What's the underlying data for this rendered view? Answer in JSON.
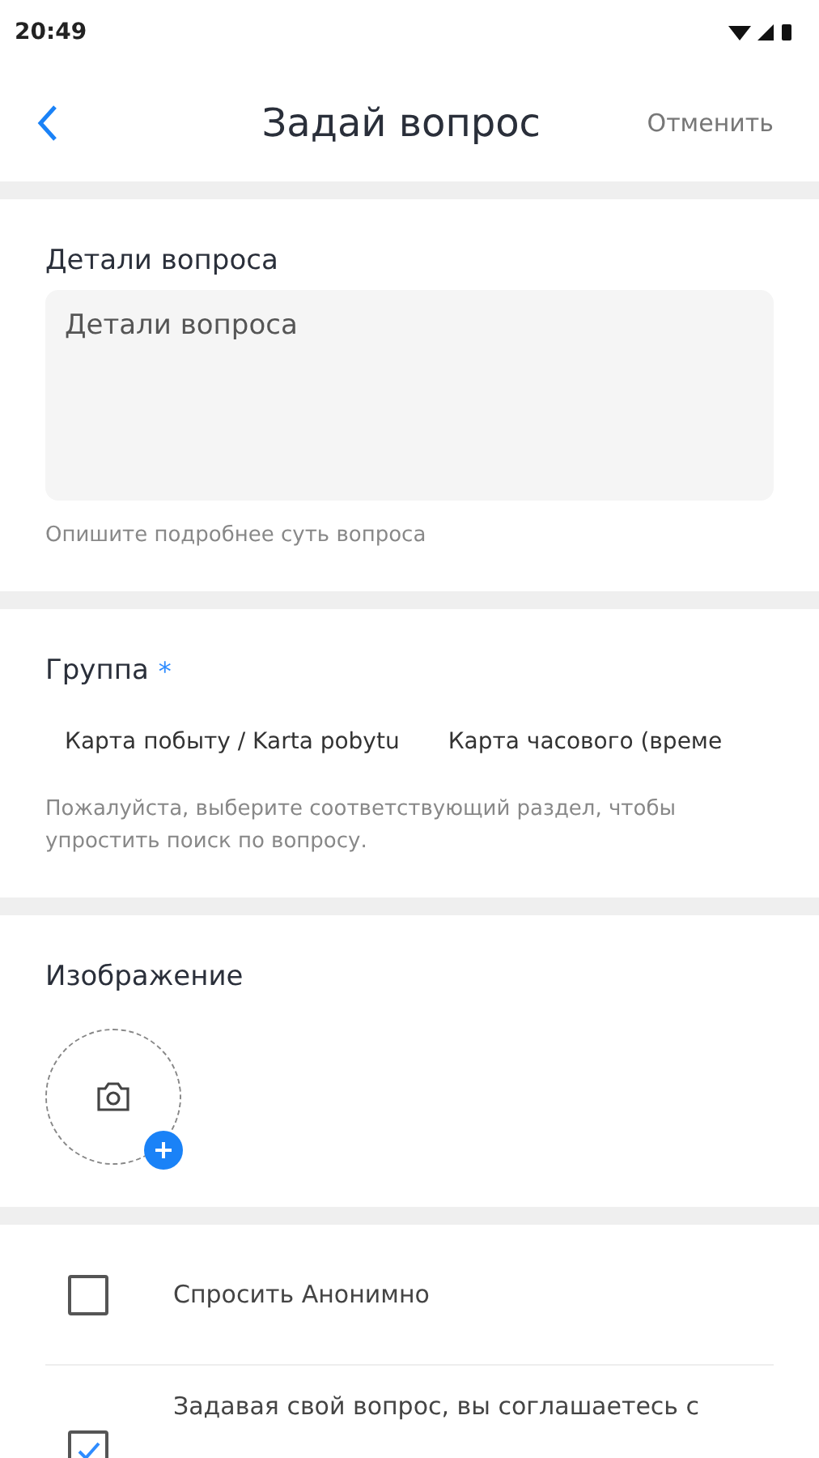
{
  "status_bar": {
    "time": "20:49"
  },
  "header": {
    "title": "Задай вопрос",
    "cancel": "Отменить"
  },
  "details": {
    "label": "Детали вопроса",
    "placeholder": "Детали вопроса",
    "hint": "Опишите подробнее суть вопроса"
  },
  "group": {
    "label": "Группа",
    "required_mark": "*",
    "options": [
      {
        "label": "Карта побыту / Karta pobytu",
        "selected": false
      },
      {
        "label": "Карта часового (време",
        "selected": false
      }
    ],
    "hint": "Пожалуйста, выберите соответствующий раздел, чтобы упростить поиск по вопросу."
  },
  "image": {
    "label": "Изображение"
  },
  "options": [
    {
      "label": "Спросить Анонимно",
      "checked": false
    },
    {
      "label": "Задавая свой вопрос, вы соглашаетесь с",
      "checked": true
    }
  ]
}
